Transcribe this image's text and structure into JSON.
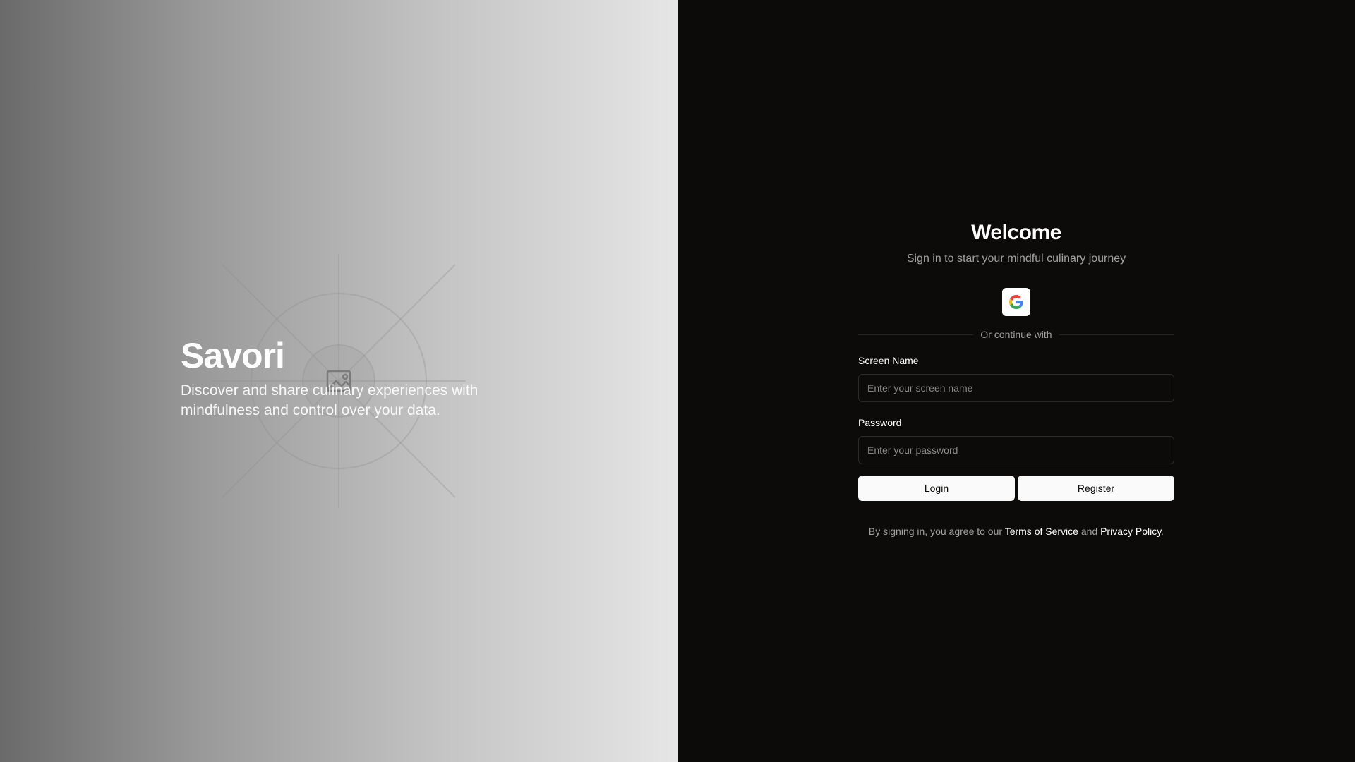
{
  "hero": {
    "brand": "Savori",
    "tagline": "Discover and share culinary experiences with mindfulness and control over your data.",
    "placeholder_icon": "image-icon"
  },
  "auth": {
    "title": "Welcome",
    "subtitle": "Sign in to start your mindful culinary journey",
    "oauth_icon": "google-icon",
    "divider": "Or continue with",
    "screen_name": {
      "label": "Screen Name",
      "placeholder": "Enter your screen name",
      "value": ""
    },
    "password": {
      "label": "Password",
      "placeholder": "Enter your password",
      "value": ""
    },
    "login_label": "Login",
    "register_label": "Register",
    "legal": {
      "prefix": "By signing in, you agree to our ",
      "terms": "Terms of Service",
      "and": " and ",
      "privacy": "Privacy Policy",
      "suffix": "."
    }
  },
  "colors": {
    "panel_bg": "#0c0b0a",
    "button_bg": "#fafafa",
    "muted_text": "#a1a1a1"
  }
}
